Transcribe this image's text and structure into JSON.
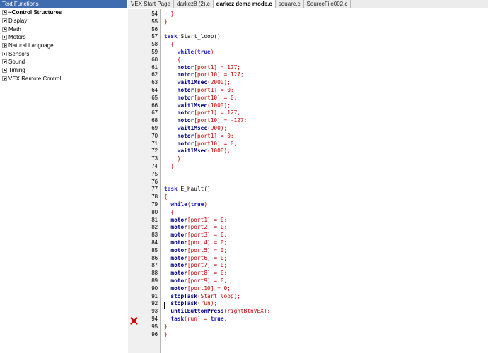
{
  "panel": {
    "title": "Text Functions",
    "items": [
      {
        "label": "~Control Structures",
        "bold": true
      },
      {
        "label": "Display"
      },
      {
        "label": "Math"
      },
      {
        "label": "Motors"
      },
      {
        "label": "Natural Language"
      },
      {
        "label": "Sensors"
      },
      {
        "label": "Sound"
      },
      {
        "label": "Timing"
      },
      {
        "label": "VEX Remote Control"
      }
    ]
  },
  "tabs": [
    {
      "label": "VEX Start Page"
    },
    {
      "label": "darkez8 (2).c"
    },
    {
      "label": "darkez demo mode.c",
      "active": true
    },
    {
      "label": "square.c"
    },
    {
      "label": "SourceFile002.c"
    }
  ],
  "colors": {
    "keyword": "#1a1ab8",
    "function": "#00007a",
    "identifier": "#c00000",
    "error": "#cc0000",
    "panel_header": "#3f6bb0"
  },
  "code_lines": [
    {
      "num": "54",
      "indent": "  ",
      "tokens": [
        [
          "}",
          "id"
        ]
      ]
    },
    {
      "num": "55",
      "indent": "",
      "tokens": [
        [
          "}",
          "id"
        ]
      ]
    },
    {
      "num": "56",
      "indent": "",
      "tokens": []
    },
    {
      "num": "57",
      "indent": "",
      "tokens": [
        [
          "task",
          "kw"
        ],
        [
          " Start_loop()",
          "pl"
        ]
      ]
    },
    {
      "num": "58",
      "indent": "  ",
      "tokens": [
        [
          "{",
          "id"
        ]
      ]
    },
    {
      "num": "59",
      "indent": "    ",
      "tokens": [
        [
          "while",
          "kw"
        ],
        [
          "(",
          "id"
        ],
        [
          "true",
          "kw"
        ],
        [
          ")",
          "id"
        ]
      ]
    },
    {
      "num": "60",
      "indent": "    ",
      "tokens": [
        [
          "{",
          "id"
        ]
      ]
    },
    {
      "num": "61",
      "indent": "    ",
      "tokens": [
        [
          "motor",
          "fn"
        ],
        [
          "[port1] = 127;",
          "id"
        ]
      ]
    },
    {
      "num": "62",
      "indent": "    ",
      "tokens": [
        [
          "motor",
          "fn"
        ],
        [
          "[port10] = 127;",
          "id"
        ]
      ]
    },
    {
      "num": "63",
      "indent": "    ",
      "tokens": [
        [
          "wait1Msec",
          "fn"
        ],
        [
          "(2000);",
          "id"
        ]
      ]
    },
    {
      "num": "64",
      "indent": "    ",
      "tokens": [
        [
          "motor",
          "fn"
        ],
        [
          "[port1] = 0;",
          "id"
        ]
      ]
    },
    {
      "num": "65",
      "indent": "    ",
      "tokens": [
        [
          "motor",
          "fn"
        ],
        [
          "[port10] = 0;",
          "id"
        ]
      ]
    },
    {
      "num": "66",
      "indent": "    ",
      "tokens": [
        [
          "wait1Msec",
          "fn"
        ],
        [
          "(1000);",
          "id"
        ]
      ]
    },
    {
      "num": "67",
      "indent": "    ",
      "tokens": [
        [
          "motor",
          "fn"
        ],
        [
          "[port1] = 127;",
          "id"
        ]
      ]
    },
    {
      "num": "68",
      "indent": "    ",
      "tokens": [
        [
          "motor",
          "fn"
        ],
        [
          "[port10] = -127;",
          "id"
        ]
      ]
    },
    {
      "num": "69",
      "indent": "    ",
      "tokens": [
        [
          "wait1Msec",
          "fn"
        ],
        [
          "(900);",
          "id"
        ]
      ]
    },
    {
      "num": "70",
      "indent": "    ",
      "tokens": [
        [
          "motor",
          "fn"
        ],
        [
          "[port1] = 0;",
          "id"
        ]
      ]
    },
    {
      "num": "71",
      "indent": "    ",
      "tokens": [
        [
          "motor",
          "fn"
        ],
        [
          "[port10] = 0;",
          "id"
        ]
      ]
    },
    {
      "num": "72",
      "indent": "    ",
      "tokens": [
        [
          "wait1Msec",
          "fn"
        ],
        [
          "(1000);",
          "id"
        ]
      ]
    },
    {
      "num": "73",
      "indent": "    ",
      "tokens": [
        [
          "}",
          "id"
        ]
      ]
    },
    {
      "num": "74",
      "indent": "  ",
      "tokens": [
        [
          "}",
          "id"
        ]
      ]
    },
    {
      "num": "75",
      "indent": "",
      "tokens": []
    },
    {
      "num": "76",
      "indent": "",
      "tokens": []
    },
    {
      "num": "77",
      "indent": "",
      "tokens": [
        [
          "task",
          "kw"
        ],
        [
          " E_hault()",
          "pl"
        ]
      ]
    },
    {
      "num": "78",
      "indent": "",
      "tokens": [
        [
          "{",
          "id"
        ]
      ]
    },
    {
      "num": "79",
      "indent": "  ",
      "tokens": [
        [
          "while",
          "kw"
        ],
        [
          "(",
          "id"
        ],
        [
          "true",
          "kw"
        ],
        [
          ")",
          "id"
        ]
      ]
    },
    {
      "num": "80",
      "indent": "  ",
      "tokens": [
        [
          "{",
          "id"
        ]
      ]
    },
    {
      "num": "81",
      "indent": "  ",
      "tokens": [
        [
          "motor",
          "fn"
        ],
        [
          "[port1] = 0;",
          "id"
        ]
      ]
    },
    {
      "num": "82",
      "indent": "  ",
      "tokens": [
        [
          "motor",
          "fn"
        ],
        [
          "[port2] = 0;",
          "id"
        ]
      ]
    },
    {
      "num": "83",
      "indent": "  ",
      "tokens": [
        [
          "motor",
          "fn"
        ],
        [
          "[port3] = 0;",
          "id"
        ]
      ]
    },
    {
      "num": "84",
      "indent": "  ",
      "tokens": [
        [
          "motor",
          "fn"
        ],
        [
          "[port4] = 0;",
          "id"
        ]
      ]
    },
    {
      "num": "85",
      "indent": "  ",
      "tokens": [
        [
          "motor",
          "fn"
        ],
        [
          "[port5] = 0;",
          "id"
        ]
      ]
    },
    {
      "num": "86",
      "indent": "  ",
      "tokens": [
        [
          "motor",
          "fn"
        ],
        [
          "[port6] = 0;",
          "id"
        ]
      ]
    },
    {
      "num": "87",
      "indent": "  ",
      "tokens": [
        [
          "motor",
          "fn"
        ],
        [
          "[port7] = 0;",
          "id"
        ]
      ]
    },
    {
      "num": "88",
      "indent": "  ",
      "tokens": [
        [
          "motor",
          "fn"
        ],
        [
          "[port8] = 0;",
          "id"
        ]
      ]
    },
    {
      "num": "89",
      "indent": "  ",
      "tokens": [
        [
          "motor",
          "fn"
        ],
        [
          "[port9] = 0;",
          "id"
        ]
      ]
    },
    {
      "num": "90",
      "indent": "  ",
      "tokens": [
        [
          "motor",
          "fn"
        ],
        [
          "[port10] = 0;",
          "id"
        ]
      ]
    },
    {
      "num": "91",
      "indent": "  ",
      "tokens": [
        [
          "stopTask",
          "fn"
        ],
        [
          "(Start_loop);",
          "id"
        ]
      ]
    },
    {
      "num": "92",
      "indent": "  ",
      "tokens": [
        [
          "stopTask",
          "fn"
        ],
        [
          "(run);",
          "id"
        ]
      ]
    },
    {
      "num": "93",
      "indent": "  ",
      "tokens": [
        [
          "untilButtonPress",
          "fn"
        ],
        [
          "(rightBtnVEX);",
          "id"
        ]
      ]
    },
    {
      "num": "94",
      "indent": "  ",
      "tokens": [
        [
          "task",
          "kw"
        ],
        [
          "(run) = ",
          "id"
        ],
        [
          "true",
          "kw"
        ],
        [
          ";",
          "id"
        ]
      ]
    },
    {
      "num": "95",
      "indent": "",
      "tokens": [
        [
          "}",
          "id"
        ]
      ]
    },
    {
      "num": "96",
      "indent": "",
      "tokens": [
        [
          "}",
          "id"
        ]
      ]
    }
  ]
}
